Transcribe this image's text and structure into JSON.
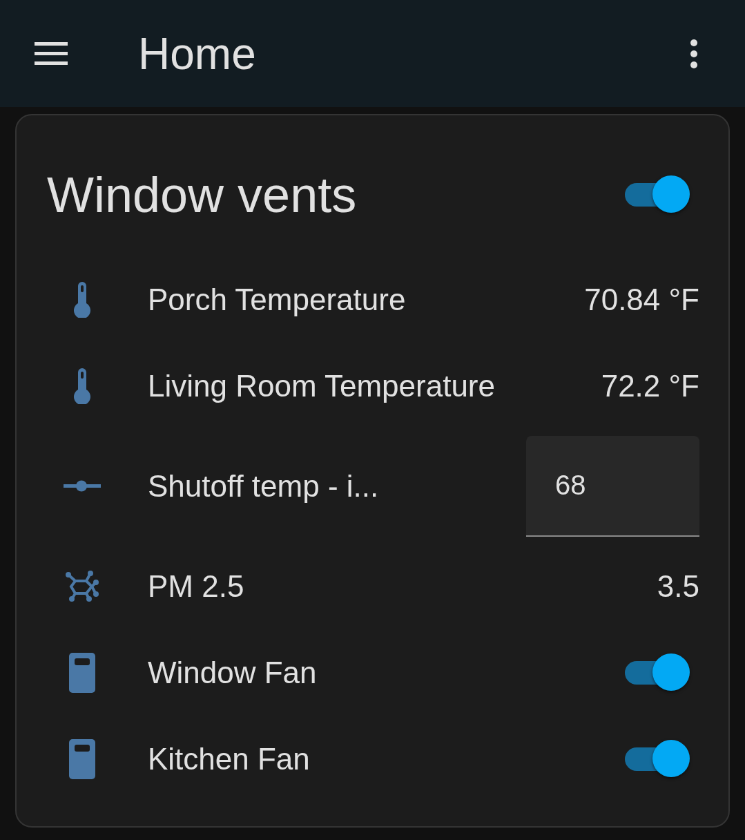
{
  "app_bar": {
    "title": "Home"
  },
  "card": {
    "title": "Window vents",
    "on": true,
    "rows": [
      {
        "kind": "temperature",
        "name": "Porch Temperature",
        "value": "70.84 °F"
      },
      {
        "kind": "temperature",
        "name": "Living Room Temperature",
        "value": "72.2 °F"
      },
      {
        "kind": "input",
        "name": "Shutoff temp - i...",
        "value": "68"
      },
      {
        "kind": "particulate",
        "name": "PM 2.5",
        "value": "3.5"
      },
      {
        "kind": "switch",
        "name": "Window Fan",
        "on": true
      },
      {
        "kind": "switch",
        "name": "Kitchen Fan",
        "on": true
      }
    ]
  }
}
